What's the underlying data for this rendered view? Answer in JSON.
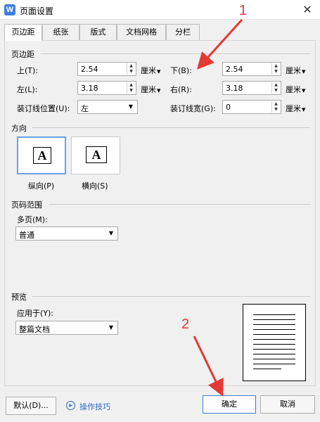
{
  "window": {
    "title": "页面设置",
    "app_icon_letter": "W",
    "close_glyph": "✕"
  },
  "tabs": [
    "页边距",
    "纸张",
    "版式",
    "文档网格",
    "分栏"
  ],
  "margins": {
    "group_label": "页边距",
    "top": {
      "label": "上(T):",
      "value": "2.54",
      "unit": "厘米"
    },
    "bottom": {
      "label": "下(B):",
      "value": "2.54",
      "unit": "厘米"
    },
    "left": {
      "label": "左(L):",
      "value": "3.18",
      "unit": "厘米"
    },
    "right": {
      "label": "右(R):",
      "value": "3.18",
      "unit": "厘米"
    },
    "gutter_position": {
      "label": "装订线位置(U):",
      "value": "左"
    },
    "gutter": {
      "label": "装订线宽(G):",
      "value": "0",
      "unit": "厘米"
    }
  },
  "orientation": {
    "group_label": "方向",
    "glyph": "A",
    "portrait_label": "纵向(P)",
    "landscape_label": "横向(S)"
  },
  "page_range": {
    "group_label": "页码范围",
    "multiple_label": "多页(M):",
    "multiple_value": "普通"
  },
  "preview": {
    "group_label": "预览",
    "apply_label": "应用于(Y):",
    "apply_value": "整篇文档"
  },
  "footer": {
    "default_button": "默认(D)...",
    "tips_link": "操作技巧",
    "ok_button": "确定",
    "cancel_button": "取消"
  },
  "annotations": {
    "one": "1",
    "two": "2"
  },
  "colors": {
    "annotation": "#e53935",
    "link": "#2a6cc7",
    "app_icon": "#3f7fe0",
    "selection": "#6aa1e8"
  }
}
